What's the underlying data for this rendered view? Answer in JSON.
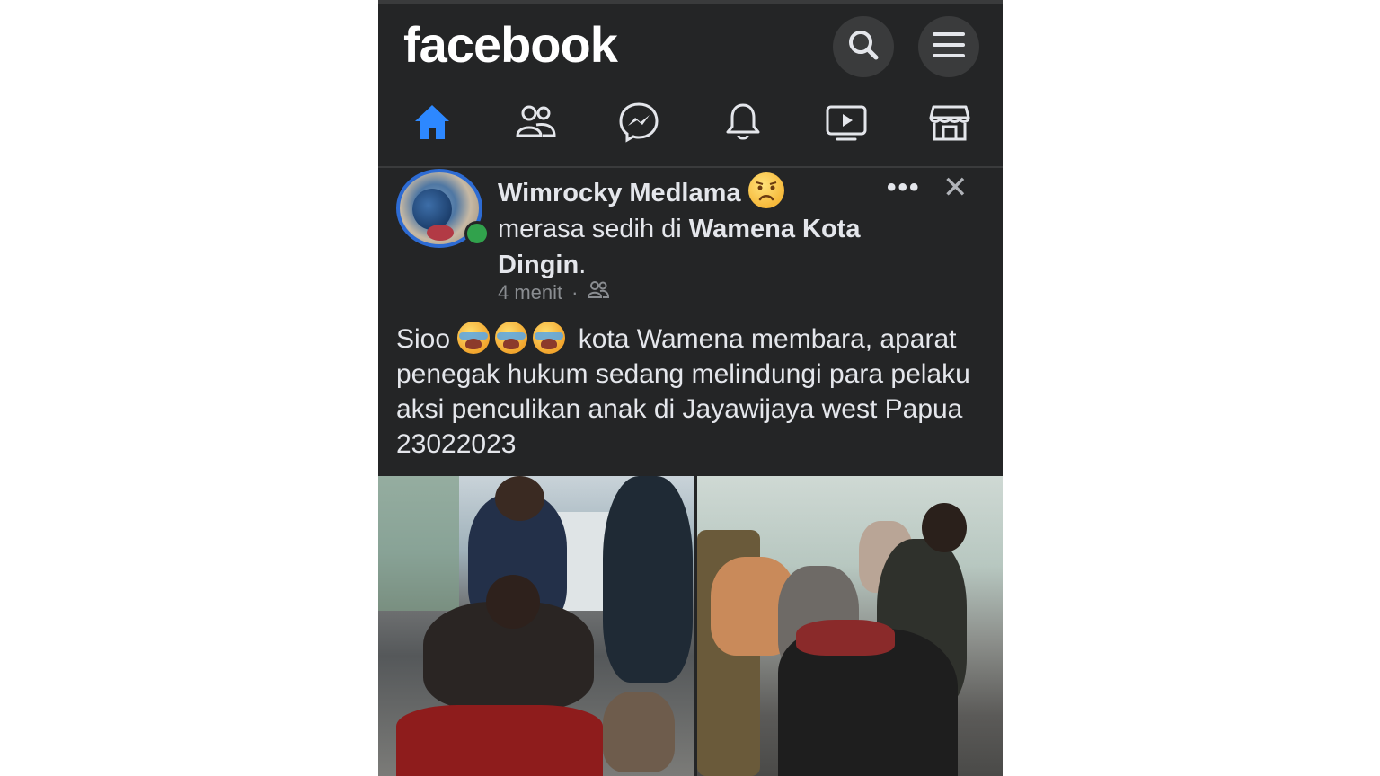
{
  "app": {
    "logo": "facebook",
    "colors": {
      "bg": "#242526",
      "text": "#e4e6eb",
      "accent": "#2d88ff",
      "online": "#31a24c"
    }
  },
  "header": {
    "icons": [
      "search-icon",
      "menu-icon"
    ]
  },
  "nav": {
    "items": [
      {
        "name": "home",
        "icon": "home-icon",
        "active": true
      },
      {
        "name": "friends",
        "icon": "friends-icon"
      },
      {
        "name": "messenger",
        "icon": "messenger-icon"
      },
      {
        "name": "notifications",
        "icon": "bell-icon"
      },
      {
        "name": "watch",
        "icon": "video-icon"
      },
      {
        "name": "marketplace",
        "icon": "marketplace-icon"
      }
    ]
  },
  "post": {
    "author": "Wimrocky Medlama",
    "feeling_text": "merasa sedih di",
    "place": "Wamena Kota Dingin",
    "place_suffix": ".",
    "time": "4 menit",
    "separator": "·",
    "audience_icon": "friends-icon",
    "text_start": "Sioo",
    "text_rest": "kota Wamena membara, aparat penegak hukum sedang melindungi para pelaku aksi penculikan anak di Jayawijaya west Papua 23022023",
    "emoji_count": 3
  }
}
